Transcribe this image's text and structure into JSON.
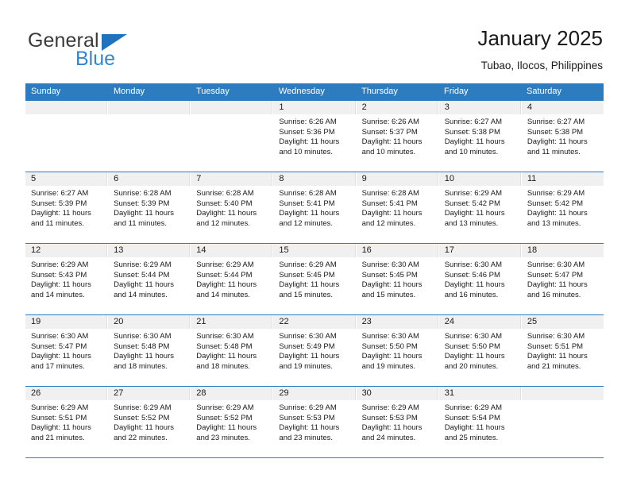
{
  "brand": {
    "name_top": "General",
    "name_bottom": "Blue",
    "triangle_icon": "blue-triangle-logo-icon",
    "color_top": "#3a3a3a",
    "color_bottom": "#2e86d4",
    "accent": "#1f72bd"
  },
  "header": {
    "title": "January 2025",
    "subtitle": "Tubao, Ilocos, Philippines"
  },
  "theme": {
    "header_blue": "#2e7cc0",
    "day_strip_gray": "#f0f0f0",
    "text_dark": "#1a1a1a"
  },
  "weekdays": [
    "Sunday",
    "Monday",
    "Tuesday",
    "Wednesday",
    "Thursday",
    "Friday",
    "Saturday"
  ],
  "weeks": [
    [
      {
        "day": "",
        "sunrise": "",
        "sunset": "",
        "daylight_line1": "",
        "daylight_line2": ""
      },
      {
        "day": "",
        "sunrise": "",
        "sunset": "",
        "daylight_line1": "",
        "daylight_line2": ""
      },
      {
        "day": "",
        "sunrise": "",
        "sunset": "",
        "daylight_line1": "",
        "daylight_line2": ""
      },
      {
        "day": "1",
        "sunrise": "Sunrise: 6:26 AM",
        "sunset": "Sunset: 5:36 PM",
        "daylight_line1": "Daylight: 11 hours",
        "daylight_line2": "and 10 minutes."
      },
      {
        "day": "2",
        "sunrise": "Sunrise: 6:26 AM",
        "sunset": "Sunset: 5:37 PM",
        "daylight_line1": "Daylight: 11 hours",
        "daylight_line2": "and 10 minutes."
      },
      {
        "day": "3",
        "sunrise": "Sunrise: 6:27 AM",
        "sunset": "Sunset: 5:38 PM",
        "daylight_line1": "Daylight: 11 hours",
        "daylight_line2": "and 10 minutes."
      },
      {
        "day": "4",
        "sunrise": "Sunrise: 6:27 AM",
        "sunset": "Sunset: 5:38 PM",
        "daylight_line1": "Daylight: 11 hours",
        "daylight_line2": "and 11 minutes."
      }
    ],
    [
      {
        "day": "5",
        "sunrise": "Sunrise: 6:27 AM",
        "sunset": "Sunset: 5:39 PM",
        "daylight_line1": "Daylight: 11 hours",
        "daylight_line2": "and 11 minutes."
      },
      {
        "day": "6",
        "sunrise": "Sunrise: 6:28 AM",
        "sunset": "Sunset: 5:39 PM",
        "daylight_line1": "Daylight: 11 hours",
        "daylight_line2": "and 11 minutes."
      },
      {
        "day": "7",
        "sunrise": "Sunrise: 6:28 AM",
        "sunset": "Sunset: 5:40 PM",
        "daylight_line1": "Daylight: 11 hours",
        "daylight_line2": "and 12 minutes."
      },
      {
        "day": "8",
        "sunrise": "Sunrise: 6:28 AM",
        "sunset": "Sunset: 5:41 PM",
        "daylight_line1": "Daylight: 11 hours",
        "daylight_line2": "and 12 minutes."
      },
      {
        "day": "9",
        "sunrise": "Sunrise: 6:28 AM",
        "sunset": "Sunset: 5:41 PM",
        "daylight_line1": "Daylight: 11 hours",
        "daylight_line2": "and 12 minutes."
      },
      {
        "day": "10",
        "sunrise": "Sunrise: 6:29 AM",
        "sunset": "Sunset: 5:42 PM",
        "daylight_line1": "Daylight: 11 hours",
        "daylight_line2": "and 13 minutes."
      },
      {
        "day": "11",
        "sunrise": "Sunrise: 6:29 AM",
        "sunset": "Sunset: 5:42 PM",
        "daylight_line1": "Daylight: 11 hours",
        "daylight_line2": "and 13 minutes."
      }
    ],
    [
      {
        "day": "12",
        "sunrise": "Sunrise: 6:29 AM",
        "sunset": "Sunset: 5:43 PM",
        "daylight_line1": "Daylight: 11 hours",
        "daylight_line2": "and 14 minutes."
      },
      {
        "day": "13",
        "sunrise": "Sunrise: 6:29 AM",
        "sunset": "Sunset: 5:44 PM",
        "daylight_line1": "Daylight: 11 hours",
        "daylight_line2": "and 14 minutes."
      },
      {
        "day": "14",
        "sunrise": "Sunrise: 6:29 AM",
        "sunset": "Sunset: 5:44 PM",
        "daylight_line1": "Daylight: 11 hours",
        "daylight_line2": "and 14 minutes."
      },
      {
        "day": "15",
        "sunrise": "Sunrise: 6:29 AM",
        "sunset": "Sunset: 5:45 PM",
        "daylight_line1": "Daylight: 11 hours",
        "daylight_line2": "and 15 minutes."
      },
      {
        "day": "16",
        "sunrise": "Sunrise: 6:30 AM",
        "sunset": "Sunset: 5:45 PM",
        "daylight_line1": "Daylight: 11 hours",
        "daylight_line2": "and 15 minutes."
      },
      {
        "day": "17",
        "sunrise": "Sunrise: 6:30 AM",
        "sunset": "Sunset: 5:46 PM",
        "daylight_line1": "Daylight: 11 hours",
        "daylight_line2": "and 16 minutes."
      },
      {
        "day": "18",
        "sunrise": "Sunrise: 6:30 AM",
        "sunset": "Sunset: 5:47 PM",
        "daylight_line1": "Daylight: 11 hours",
        "daylight_line2": "and 16 minutes."
      }
    ],
    [
      {
        "day": "19",
        "sunrise": "Sunrise: 6:30 AM",
        "sunset": "Sunset: 5:47 PM",
        "daylight_line1": "Daylight: 11 hours",
        "daylight_line2": "and 17 minutes."
      },
      {
        "day": "20",
        "sunrise": "Sunrise: 6:30 AM",
        "sunset": "Sunset: 5:48 PM",
        "daylight_line1": "Daylight: 11 hours",
        "daylight_line2": "and 18 minutes."
      },
      {
        "day": "21",
        "sunrise": "Sunrise: 6:30 AM",
        "sunset": "Sunset: 5:48 PM",
        "daylight_line1": "Daylight: 11 hours",
        "daylight_line2": "and 18 minutes."
      },
      {
        "day": "22",
        "sunrise": "Sunrise: 6:30 AM",
        "sunset": "Sunset: 5:49 PM",
        "daylight_line1": "Daylight: 11 hours",
        "daylight_line2": "and 19 minutes."
      },
      {
        "day": "23",
        "sunrise": "Sunrise: 6:30 AM",
        "sunset": "Sunset: 5:50 PM",
        "daylight_line1": "Daylight: 11 hours",
        "daylight_line2": "and 19 minutes."
      },
      {
        "day": "24",
        "sunrise": "Sunrise: 6:30 AM",
        "sunset": "Sunset: 5:50 PM",
        "daylight_line1": "Daylight: 11 hours",
        "daylight_line2": "and 20 minutes."
      },
      {
        "day": "25",
        "sunrise": "Sunrise: 6:30 AM",
        "sunset": "Sunset: 5:51 PM",
        "daylight_line1": "Daylight: 11 hours",
        "daylight_line2": "and 21 minutes."
      }
    ],
    [
      {
        "day": "26",
        "sunrise": "Sunrise: 6:29 AM",
        "sunset": "Sunset: 5:51 PM",
        "daylight_line1": "Daylight: 11 hours",
        "daylight_line2": "and 21 minutes."
      },
      {
        "day": "27",
        "sunrise": "Sunrise: 6:29 AM",
        "sunset": "Sunset: 5:52 PM",
        "daylight_line1": "Daylight: 11 hours",
        "daylight_line2": "and 22 minutes."
      },
      {
        "day": "28",
        "sunrise": "Sunrise: 6:29 AM",
        "sunset": "Sunset: 5:52 PM",
        "daylight_line1": "Daylight: 11 hours",
        "daylight_line2": "and 23 minutes."
      },
      {
        "day": "29",
        "sunrise": "Sunrise: 6:29 AM",
        "sunset": "Sunset: 5:53 PM",
        "daylight_line1": "Daylight: 11 hours",
        "daylight_line2": "and 23 minutes."
      },
      {
        "day": "30",
        "sunrise": "Sunrise: 6:29 AM",
        "sunset": "Sunset: 5:53 PM",
        "daylight_line1": "Daylight: 11 hours",
        "daylight_line2": "and 24 minutes."
      },
      {
        "day": "31",
        "sunrise": "Sunrise: 6:29 AM",
        "sunset": "Sunset: 5:54 PM",
        "daylight_line1": "Daylight: 11 hours",
        "daylight_line2": "and 25 minutes."
      },
      {
        "day": "",
        "sunrise": "",
        "sunset": "",
        "daylight_line1": "",
        "daylight_line2": ""
      }
    ]
  ]
}
